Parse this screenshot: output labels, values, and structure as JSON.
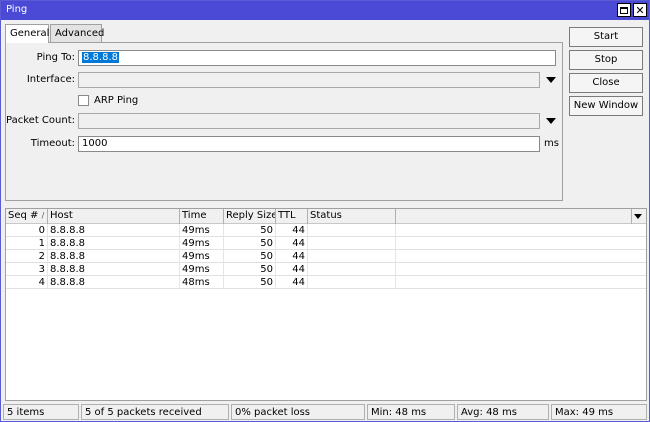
{
  "window": {
    "title": "Ping"
  },
  "tabs": [
    {
      "label": "General",
      "active": true
    },
    {
      "label": "Advanced",
      "active": false
    }
  ],
  "form": {
    "ping_to": {
      "label": "Ping To:",
      "value": "8.8.8.8"
    },
    "interface": {
      "label": "Interface:",
      "value": ""
    },
    "arp_ping": {
      "label": "ARP Ping",
      "checked": false
    },
    "packet_count": {
      "label": "Packet Count:",
      "value": ""
    },
    "timeout": {
      "label": "Timeout:",
      "value": "1000",
      "unit": "ms"
    }
  },
  "buttons": {
    "start": "Start",
    "stop": "Stop",
    "close": "Close",
    "new_window": "New Window"
  },
  "table": {
    "columns": [
      "Seq #",
      "Host",
      "Time",
      "Reply Size",
      "TTL",
      "Status"
    ],
    "sort_indicator": "/",
    "rows": [
      {
        "seq": "0",
        "host": "8.8.8.8",
        "time": "49ms",
        "size": "50",
        "ttl": "44",
        "status": ""
      },
      {
        "seq": "1",
        "host": "8.8.8.8",
        "time": "49ms",
        "size": "50",
        "ttl": "44",
        "status": ""
      },
      {
        "seq": "2",
        "host": "8.8.8.8",
        "time": "49ms",
        "size": "50",
        "ttl": "44",
        "status": ""
      },
      {
        "seq": "3",
        "host": "8.8.8.8",
        "time": "49ms",
        "size": "50",
        "ttl": "44",
        "status": ""
      },
      {
        "seq": "4",
        "host": "8.8.8.8",
        "time": "48ms",
        "size": "50",
        "ttl": "44",
        "status": ""
      }
    ]
  },
  "status": {
    "items": "5 items",
    "received": "5 of 5 packets received",
    "loss": "0% packet loss",
    "min": "Min: 48 ms",
    "avg": "Avg: 48 ms",
    "max": "Max: 49 ms"
  },
  "colors": {
    "titlebar": "#4a4ad6",
    "selection": "#0078d7"
  }
}
